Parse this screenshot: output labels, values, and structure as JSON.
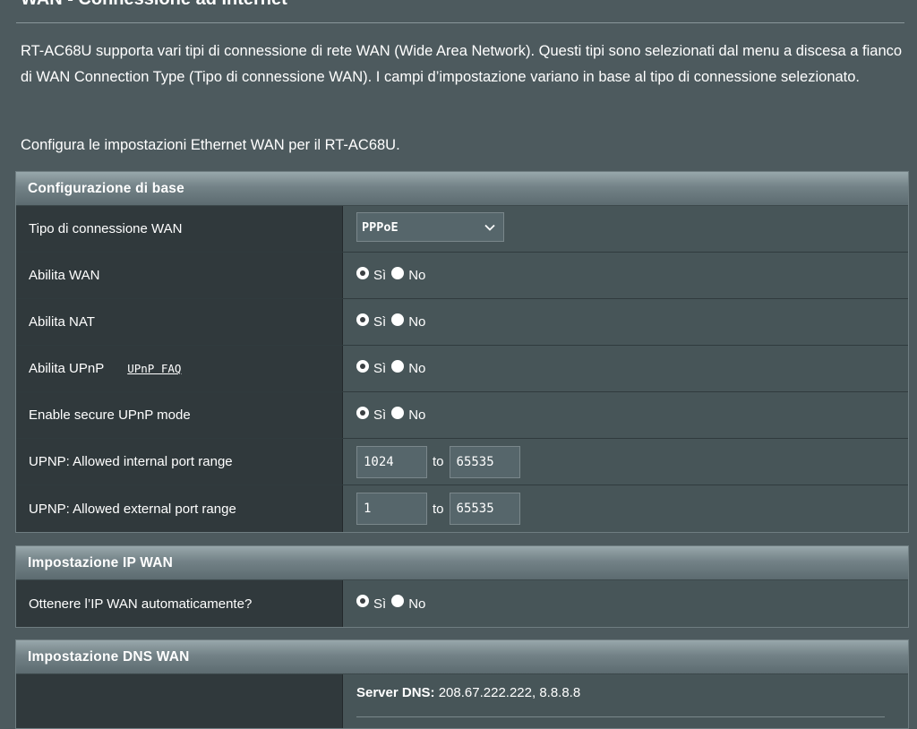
{
  "page": {
    "title": "WAN - Connessione ad Internet",
    "intro": "RT-AC68U supporta vari tipi di connessione di rete WAN (Wide Area Network). Questi tipi sono selezionati dal menu a discesa a fianco di WAN Connection Type (Tipo di connessione WAN). I campi d’impostazione variano in base al tipo di connessione selezionato.",
    "sub_intro": "Configura le impostazioni Ethernet WAN per il RT-AC68U."
  },
  "basic": {
    "header": "Configurazione di base",
    "wan_type": {
      "label": "Tipo di connessione WAN",
      "value": "PPPoE"
    },
    "enable_wan": {
      "label": "Abilita WAN",
      "yes": "Sì",
      "no": "No",
      "selected": "yes"
    },
    "enable_nat": {
      "label": "Abilita NAT",
      "yes": "Sì",
      "no": "No",
      "selected": "yes"
    },
    "enable_upnp": {
      "label": "Abilita UPnP",
      "faq": "UPnP FAQ",
      "yes": "Sì",
      "no": "No",
      "selected": "yes"
    },
    "secure_upnp": {
      "label": "Enable secure UPnP mode",
      "yes": "Sì",
      "no": "No",
      "selected": "yes"
    },
    "internal_range": {
      "label": "UPNP: Allowed internal port range",
      "from": "1024",
      "sep": "to",
      "to": "65535"
    },
    "external_range": {
      "label": "UPNP: Allowed external port range",
      "from": "1",
      "sep": "to",
      "to": "65535"
    }
  },
  "wan_ip": {
    "header": "Impostazione IP WAN",
    "auto_ip": {
      "label": "Ottenere l’IP WAN automaticamente?",
      "yes": "Sì",
      "no": "No",
      "selected": "yes"
    }
  },
  "wan_dns": {
    "header": "Impostazione DNS WAN",
    "dns_label": "Server DNS:",
    "dns_value": "208.67.222.222, 8.8.8.8"
  },
  "colors": {
    "background": "#4d5a5e",
    "label_cell": "#30393c",
    "value_cell": "#475558"
  }
}
